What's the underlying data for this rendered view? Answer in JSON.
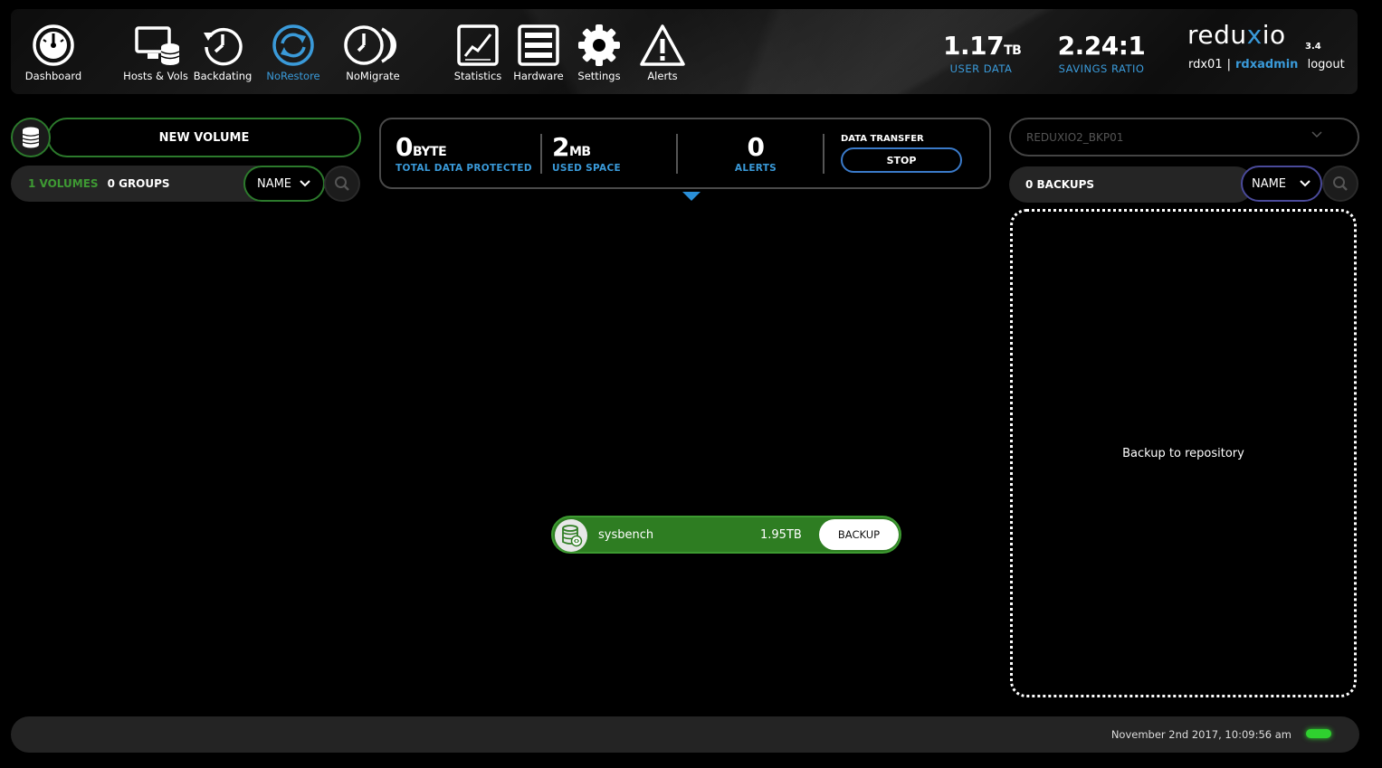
{
  "nav": {
    "items": [
      {
        "label": "Dashboard",
        "icon": "speedometer-icon"
      },
      {
        "label": "Hosts & Vols",
        "icon": "monitor-database-icon"
      },
      {
        "label": "Backdating",
        "icon": "clock-history-icon"
      },
      {
        "label": "NoRestore",
        "icon": "refresh-cycle-icon",
        "active": true
      },
      {
        "label": "NoMigrate",
        "icon": "clock-double-icon"
      },
      {
        "label": "Statistics",
        "icon": "line-chart-icon"
      },
      {
        "label": "Hardware",
        "icon": "server-rack-icon"
      },
      {
        "label": "Settings",
        "icon": "gear-icon"
      },
      {
        "label": "Alerts",
        "icon": "warning-icon"
      }
    ]
  },
  "header": {
    "user_data_value": "1.17",
    "user_data_unit": "TB",
    "user_data_label": "USER DATA",
    "savings_value": "2.24:1",
    "savings_label": "SAVINGS RATIO",
    "brand_prefix": "redu",
    "brand_x": "x",
    "brand_suffix": "io",
    "version": "3.4",
    "system_name": "rdx01",
    "separator": "|",
    "username": "rdxadmin",
    "logout_label": "logout"
  },
  "left": {
    "new_volume_label": "NEW VOLUME",
    "volumes_count_text": "1 VOLUMES",
    "groups_count_text": "0 GROUPS",
    "sort_label": "NAME"
  },
  "stats": {
    "protected_value": "0",
    "protected_unit": "BYTE",
    "protected_label": "TOTAL DATA PROTECTED",
    "used_value": "2",
    "used_unit": "MB",
    "used_label": "USED SPACE",
    "alerts_value": "0",
    "alerts_label": "ALERTS",
    "transfer_label": "DATA TRANSFER",
    "stop_label": "STOP"
  },
  "volume": {
    "name": "sysbench",
    "size": "1.95TB",
    "backup_label": "BACKUP"
  },
  "right": {
    "repository": "REDUXIO2_BKP01",
    "backups_count_text": "0 BACKUPS",
    "sort_label": "NAME",
    "drop_zone_text": "Backup to repository"
  },
  "footer": {
    "timestamp": "November 2nd 2017, 10:09:56 am"
  },
  "colors": {
    "accent_blue": "#3a9ad9",
    "volume_green": "#2e7d22",
    "led_green": "#2fd02f"
  }
}
